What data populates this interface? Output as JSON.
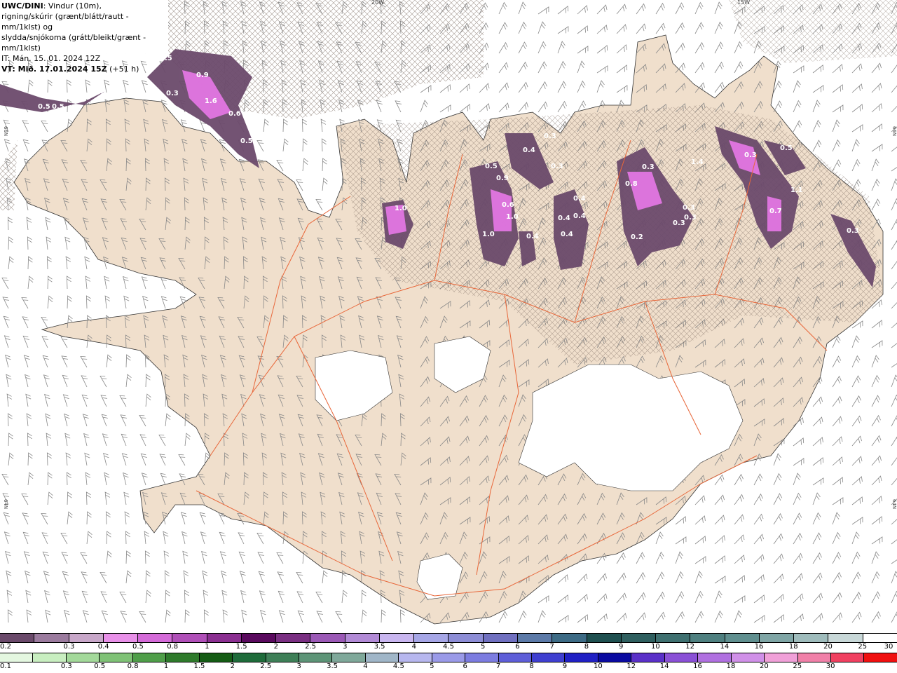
{
  "header": {
    "brand": "UWC/DINI",
    "line1_rest": ": Vindur (10m),",
    "line2": "rigning/skúrir (grænt/blátt/rautt - mm/1klst) og",
    "line3": "slydda/snjókoma (grátt/bleikt/grænt - mm/1klst)",
    "init_time": "IT: Mán. 15. 01. 2024 12Z",
    "valid_bold": "VT: Mið. 17.01.2024 15Z",
    "valid_offset": " (+51 h)"
  },
  "map": {
    "land_color": "#f0dfcc",
    "roads_color": "#e8673a",
    "glacier_color": "#ffffff",
    "meridian_labels": [
      "20W",
      "15W"
    ],
    "parallel_labels": [
      "66N",
      "66N",
      "64N",
      "64N"
    ],
    "precip_labels": [
      "0.5",
      "0.9",
      "0.3",
      "1.6",
      "0.6",
      "0.5",
      "0.5",
      "0.5",
      "0.3",
      "1.0",
      "0.5",
      "0.9",
      "0.6",
      "1.0",
      "1.0",
      "0.3",
      "0.4",
      "0.4",
      "0.3",
      "0.4",
      "0.4",
      "0.4",
      "0.4",
      "0.8",
      "0.3",
      "0.3",
      "0.3",
      "0.3",
      "0.2",
      "1.4",
      "0.3",
      "0.5",
      "1.1",
      "0.7",
      "0.3"
    ]
  },
  "legend_snow": {
    "colors": [
      "#6b4a6b",
      "#9b7b9e",
      "#c8a7c9",
      "#e890e8",
      "#d46ad8",
      "#b04fb8",
      "#8b2f91",
      "#5a0a5e",
      "#7a2f82",
      "#9b59b6",
      "#b28ad6",
      "#c9b6f0",
      "#a6a6e6",
      "#8d8dd6",
      "#7070c0",
      "#5c7aa8",
      "#3d6b85",
      "#1f5050",
      "#2f5f5f",
      "#3f7070",
      "#4f8080",
      "#608f8f",
      "#7fa5a5",
      "#9fbcbc",
      "#c8d8d8",
      "#ffffff"
    ],
    "ticks": [
      "0.2",
      "0.3",
      "0.4",
      "0.5",
      "0.8",
      "1",
      "1.5",
      "2",
      "2.5",
      "3",
      "3.5",
      "4",
      "4.5",
      "5",
      "6",
      "7",
      "8",
      "9",
      "10",
      "12",
      "14",
      "16",
      "18",
      "20",
      "25",
      "30"
    ]
  },
  "legend_rain": {
    "colors": [
      "#e4f7e0",
      "#c8eec0",
      "#a3d99a",
      "#7fc276",
      "#4f9e49",
      "#2e7a2b",
      "#145c15",
      "#1e6b3a",
      "#3e7f57",
      "#5d9477",
      "#7fa89a",
      "#a0b6c8",
      "#b7b7ee",
      "#9a9ae8",
      "#7c7ce0",
      "#5e5ed8",
      "#3f3fd0",
      "#2020c4",
      "#0a0aa0",
      "#5a30c8",
      "#8a50d6",
      "#b070e0",
      "#d090e8",
      "#f0a0d8",
      "#f080a8",
      "#f04060",
      "#f01010"
    ],
    "ticks": [
      "0.1",
      "0.3",
      "0.5",
      "0.8",
      "1",
      "1.5",
      "2",
      "2.5",
      "3",
      "3.5",
      "4",
      "4.5",
      "5",
      "6",
      "7",
      "8",
      "9",
      "10",
      "12",
      "14",
      "16",
      "18",
      "20",
      "25",
      "30"
    ]
  }
}
